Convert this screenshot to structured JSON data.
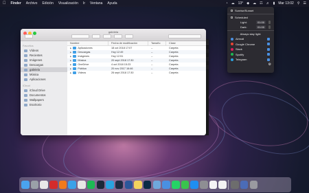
{
  "menubar": {
    "app": "Finder",
    "menus": [
      "Archivo",
      "Edición",
      "Visualización",
      "Ir",
      "Ventana",
      "Ayuda"
    ],
    "temperature": "13°",
    "clock": "Mar 13:02"
  },
  "finder": {
    "title": "gabriela",
    "sidebar": {
      "favorites_header": "Favoritos",
      "favorites": [
        "Vídeos",
        "Recientes",
        "Imágenes",
        "Descargas",
        "gabriela",
        "Música",
        "Aplicaciones"
      ],
      "selected": "gabriela",
      "icloud_header": "iCloud",
      "icloud": [
        "iCloud Drive",
        "Documentos",
        "Wallpapers",
        "Escritorio"
      ]
    },
    "columns": [
      "Nombre",
      "Fecha de modificación",
      "Tamaño",
      "Clase"
    ],
    "rows": [
      {
        "name": "Aplicaciones",
        "date": "18 oct 2018 17:07",
        "size": "--",
        "kind": "Carpeta"
      },
      {
        "name": "Descargas",
        "date": "Hoy 12:49",
        "size": "--",
        "kind": "Carpeta"
      },
      {
        "name": "Imágenes",
        "date": "Hoy 12:51",
        "size": "--",
        "kind": "Carpeta"
      },
      {
        "name": "Música",
        "date": "20 sept 2018 17:30",
        "size": "--",
        "kind": "Carpeta"
      },
      {
        "name": "OneDrive",
        "date": "4 oct 2018 15:23",
        "size": "--",
        "kind": "Carpeta"
      },
      {
        "name": "Pública",
        "date": "20 nov 2017 16:46",
        "size": "--",
        "kind": "Carpeta"
      },
      {
        "name": "Vídeos",
        "date": "26 sept 2018 17:30",
        "size": "--",
        "kind": "Carpeta"
      }
    ]
  },
  "darkpanel": {
    "header": "Clase",
    "rows": [
      {
        "size": "--",
        "kind": "Carpeta"
      },
      {
        "size": "--",
        "kind": "Carpeta"
      },
      {
        "size": "--",
        "kind": "Carpeta"
      },
      {
        "size": "--",
        "kind": "Carpeta"
      },
      {
        "size": "--",
        "kind": "Carpeta"
      },
      {
        "size": "--",
        "kind": "Carpeta"
      },
      {
        "size": "--",
        "kind": "Carpeta"
      }
    ]
  },
  "popup": {
    "sunrise_label": "Sunrise/Sunset",
    "scheduled_label": "Scheduled",
    "light_label": "Light:",
    "light_time": "01:00",
    "dark_label": "Dark:",
    "dark_time": "01:00",
    "always_light": "Always stay light:",
    "apps": [
      {
        "name": "Airmail",
        "color": "#4a90e2"
      },
      {
        "name": "Google Chrome",
        "color": "#ea4335"
      },
      {
        "name": "Slack",
        "color": "#e01e5a"
      },
      {
        "name": "Spotify",
        "color": "#1db954"
      },
      {
        "name": "Telegram",
        "color": "#2aa3df"
      }
    ]
  },
  "dock": {
    "icons": [
      "finder-icon",
      "launchpad-icon",
      "chrome-icon",
      "opera-icon",
      "firefox-icon",
      "tweetbot-icon",
      "slack-icon",
      "spotify-icon",
      "steam-icon",
      "telegram-icon",
      "paw-icon",
      "word-icon",
      "notes-icon",
      "photoshop-icon",
      "preview-icon",
      "airmail-icon",
      "whatsapp-icon",
      "messages-icon",
      "appstore-icon",
      "settings-icon",
      "calendar-icon",
      "photos-icon",
      "archive-icon",
      "downloads-icon",
      "trash-icon"
    ],
    "colors": [
      "#4aa3ee",
      "#9aa0a8",
      "#e8e8e8",
      "#d32b2b",
      "#f07a1c",
      "#3aa1e8",
      "#e6e6e6",
      "#1db954",
      "#1b2838",
      "#2aa3df",
      "#1d2c44",
      "#2b579a",
      "#f4d35e",
      "#0b2a46",
      "#6fa8dc",
      "#4a90e2",
      "#25d366",
      "#3ac34d",
      "#1f8ef1",
      "#8e8e93",
      "#f5f5f5",
      "#f2f2f2",
      "#6d6d6d",
      "#4b6cb7",
      "#9a9aa0"
    ]
  }
}
